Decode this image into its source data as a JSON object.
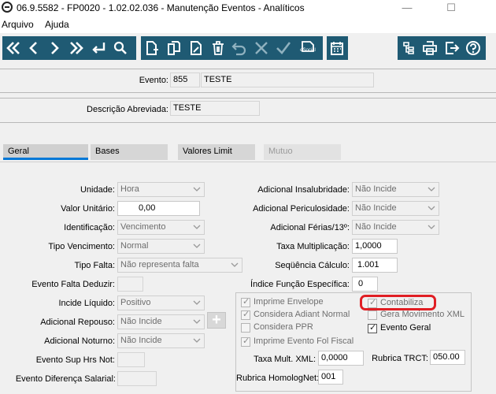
{
  "window": {
    "title": "06.9.5582 - FP0020 - 1.02.02.036 - Manutenção Eventos - Analíticos",
    "minimize_glyph": "—",
    "maximize_glyph": "☐"
  },
  "menu": {
    "items": [
      "Arquivo",
      "Ajuda"
    ]
  },
  "toolbar": {
    "first_glyph": "«",
    "prev_glyph": "‹",
    "next_glyph": "›",
    "last_glyph": "»",
    "esocial_label": "eSocial",
    "icons": [
      "first-record-icon",
      "previous-record-icon",
      "next-record-icon",
      "last-record-icon",
      "return-icon",
      "search-icon",
      "new-document-icon",
      "copy-document-icon",
      "edit-document-icon",
      "delete-icon",
      "undo-icon",
      "cancel-icon",
      "confirm-icon",
      "esocial-icon",
      "calendar-icon",
      "hierarchy-icon",
      "print-icon",
      "exit-icon",
      "help-icon"
    ]
  },
  "header": {
    "evento_label": "Evento:",
    "evento_code": "855",
    "evento_name": "TESTE",
    "descricao_label": "Descrição Abreviada:",
    "descricao_value": "TESTE"
  },
  "tabs": [
    {
      "label": "Geral",
      "state": "active"
    },
    {
      "label": "Bases",
      "state": "normal"
    },
    {
      "label": "Valores Limit",
      "state": "normal"
    },
    {
      "label": "Mutuo",
      "state": "disabled"
    }
  ],
  "geral": {
    "left": {
      "unidade_label": "Unidade:",
      "unidade_value": "Hora",
      "valor_unitario_label": "Valor Unitário:",
      "valor_unitario_value": "0,00",
      "identificacao_label": "Identificação:",
      "identificacao_value": "Vencimento",
      "tipo_vencimento_label": "Tipo Vencimento:",
      "tipo_vencimento_value": "Normal",
      "tipo_falta_label": "Tipo Falta:",
      "tipo_falta_value": "Não representa falta",
      "evento_falta_label": "Evento Falta Deduzir:",
      "evento_falta_value": "",
      "incide_liquido_label": "Incide Líquido:",
      "incide_liquido_value": "Positivo",
      "adicional_repouso_label": "Adicional Repouso:",
      "adicional_repouso_value": "Não Incide",
      "adicional_noturno_label": "Adicional Noturno:",
      "adicional_noturno_value": "Não Incide",
      "evento_sup_label": "Evento Sup Hrs Not:",
      "evento_sup_value": "",
      "evento_dif_label": "Evento Diferença Salarial:",
      "evento_dif_value": "",
      "plus_glyph": "+"
    },
    "right": {
      "insalubridade_label": "Adicional Insalubridade:",
      "insalubridade_value": "Não Incide",
      "periculosidade_label": "Adicional Periculosidade:",
      "periculosidade_value": "Não Incide",
      "ferias_label": "Adicional Férias/13º:",
      "ferias_value": "Não Incide",
      "taxa_mult_label": "Taxa Multiplicação:",
      "taxa_mult_value": "1,0000",
      "sequencia_label": "Seqüência Cálculo:",
      "sequencia_value": "1.001",
      "indice_label": "Índice Função Específica:",
      "indice_value": "0"
    },
    "checkboxes": {
      "imprime_envelope": {
        "label": "Imprime Envelope",
        "checked": true,
        "enabled": false
      },
      "considera_adiant": {
        "label": "Considera Adiant Normal",
        "checked": true,
        "enabled": false
      },
      "considera_ppr": {
        "label": "Considera PPR",
        "checked": false,
        "enabled": false
      },
      "imprime_evento_fol": {
        "label": "Imprime Evento Fol Fiscal",
        "checked": true,
        "enabled": false
      },
      "contabiliza": {
        "label": "Contabiliza",
        "checked": true,
        "enabled": false
      },
      "gera_movimento_xml": {
        "label": "Gera Movimento XML",
        "checked": false,
        "enabled": false
      },
      "evento_geral": {
        "label": "Evento Geral",
        "checked": true,
        "enabled": true
      }
    },
    "taxa_mult_xml_label": "Taxa Mult. XML:",
    "taxa_mult_xml_value": "0,0000",
    "rubrica_trct_label": "Rubrica TRCT:",
    "rubrica_trct_value": "050.00",
    "rubrica_homolog_label": "Rubrica HomologNet:",
    "rubrica_homolog_value": "001"
  },
  "colors": {
    "toolbar": "#1f5a73",
    "highlight": "#e01e24",
    "active_tab": "#0078d7"
  }
}
